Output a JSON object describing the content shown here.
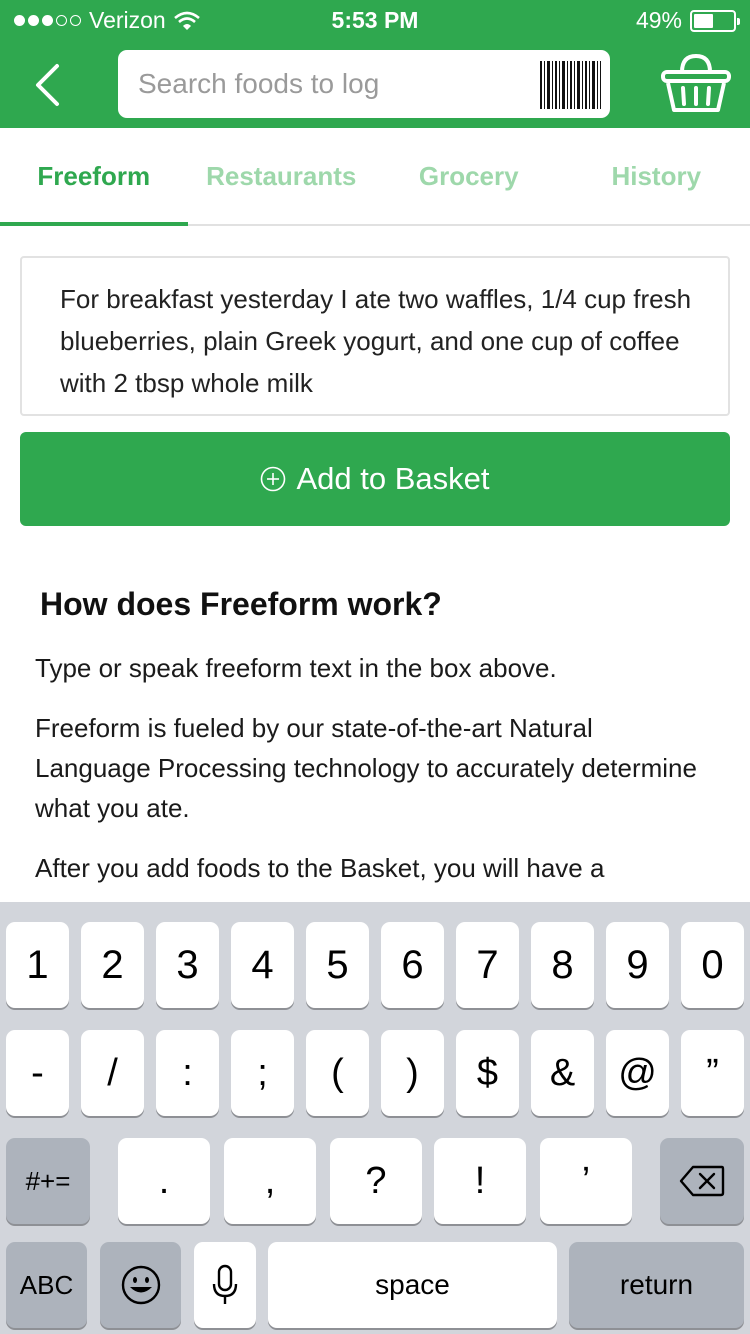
{
  "status_bar": {
    "carrier": "Verizon",
    "time": "5:53 PM",
    "battery": "49%",
    "battery_level": 0.49,
    "icons": [
      "signal-dots-icon",
      "wifi-icon",
      "battery-icon"
    ]
  },
  "nav": {
    "back_icon": "chevron-left-icon",
    "search_placeholder": "Search foods to log",
    "barcode_icon": "barcode-icon",
    "basket_icon": "basket-icon"
  },
  "tabs": [
    {
      "label": "Freeform",
      "active": true
    },
    {
      "label": "Restaurants",
      "active": false
    },
    {
      "label": "Grocery",
      "active": false
    },
    {
      "label": "History",
      "active": false
    }
  ],
  "freeform": {
    "text": "For breakfast yesterday I ate two waffles, 1/4 cup fresh blueberries, plain Greek yogurt, and one cup of coffee with 2 tbsp whole milk"
  },
  "add_button": {
    "label": "Add to Basket",
    "icon": "plus-circle-icon"
  },
  "info": {
    "title": "How does Freeform work?",
    "paragraphs": [
      "Type or speak freeform text in the box above.",
      "Freeform is fueled by our state-of-the-art Natural Language Processing technology to accurately determine what you ate.",
      "After you add foods to the Basket, you will have a"
    ]
  },
  "keyboard": {
    "row1": [
      "1",
      "2",
      "3",
      "4",
      "5",
      "6",
      "7",
      "8",
      "9",
      "0"
    ],
    "row2": [
      "-",
      "/",
      ":",
      ";",
      "(",
      ")",
      "$",
      "&",
      "@",
      "”"
    ],
    "row3_mode": "#+=",
    "row3": [
      ".",
      ",",
      "?",
      "!",
      "’"
    ],
    "row3_delete_icon": "backspace-icon",
    "row4_abc": "ABC",
    "row4_emoji_icon": "emoji-icon",
    "row4_mic_icon": "microphone-icon",
    "row4_space": "space",
    "row4_return": "return"
  },
  "colors": {
    "brand_green": "#2fa84f",
    "tab_inactive": "#9ed8ab",
    "keyboard_bg": "#d2d5db",
    "key_dark": "#adb3bc"
  }
}
